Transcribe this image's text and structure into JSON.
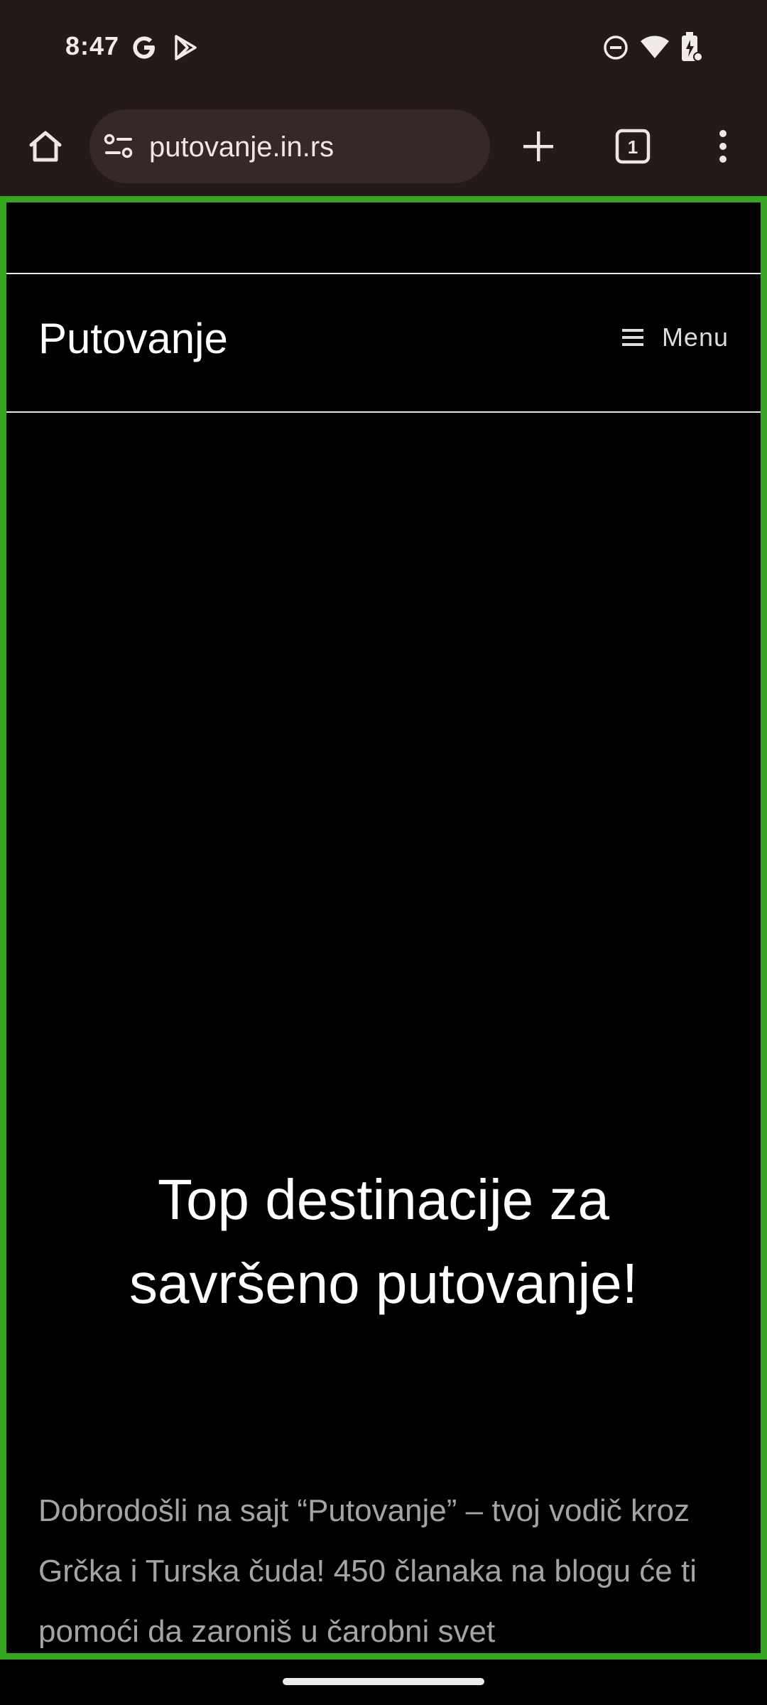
{
  "status_bar": {
    "time": "8:47",
    "icons": [
      "google-g-icon",
      "play-store-icon",
      "do-not-disturb-icon",
      "wifi-icon",
      "battery-charging-icon"
    ]
  },
  "browser": {
    "url": "putovanje.in.rs",
    "tab_count": "1",
    "icons": [
      "home-icon",
      "site-settings-icon",
      "new-tab-plus-icon",
      "tab-switcher-icon",
      "more-vert-icon"
    ]
  },
  "site": {
    "title": "Putovanje",
    "menu_label": "Menu",
    "hero_heading": "Top destinacije za savršeno putovanje!",
    "intro_text": "Dobrodošli na sajt “Putovanje” – tvoj vodič kroz Grčka i Turska čuda! 450 članaka na blogu će ti pomoći da zaroniš u čarobni svet"
  },
  "colors": {
    "chrome_background": "#231a19",
    "url_pill": "#362826",
    "page_background": "#000000",
    "focus_outline": "#37a51f",
    "intro_text": "#a4a4a4"
  }
}
